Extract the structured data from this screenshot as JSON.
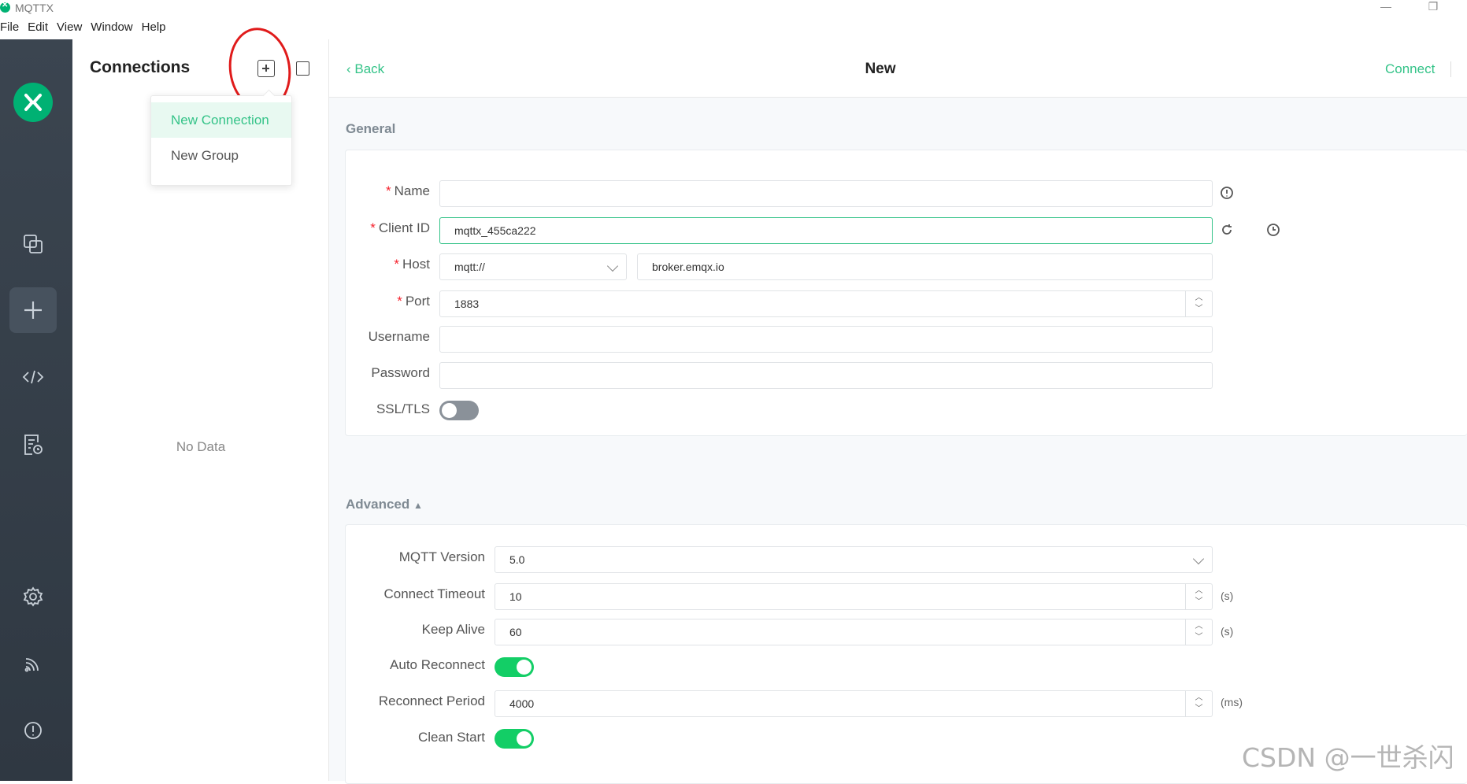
{
  "window": {
    "title": "MQTTX",
    "minimize_glyph": "—",
    "maximize_glyph": "❐"
  },
  "menu": [
    "File",
    "Edit",
    "View",
    "Window",
    "Help"
  ],
  "nav": {
    "items": [
      "connections-icon",
      "new-connection-icon",
      "script-icon",
      "log-icon",
      "settings-icon",
      "subscribe-feed-icon",
      "about-icon"
    ],
    "active": "new-connection-icon"
  },
  "connections": {
    "title": "Connections",
    "dropdown": [
      "New Connection",
      "New Group"
    ],
    "empty_text": "No Data"
  },
  "topbar": {
    "back_label": "Back",
    "title": "New",
    "connect_label": "Connect"
  },
  "general": {
    "section_label": "General",
    "name_label": "Name",
    "name_value": "",
    "client_id_label": "Client ID",
    "client_id_value": "mqttx_455ca222",
    "host_label": "Host",
    "host_protocol": "mqtt://",
    "host_value": "broker.emqx.io",
    "port_label": "Port",
    "port_value": "1883",
    "username_label": "Username",
    "username_value": "",
    "password_label": "Password",
    "password_value": "",
    "ssl_label": "SSL/TLS",
    "ssl_enabled": false
  },
  "advanced": {
    "section_label": "Advanced",
    "mqtt_version_label": "MQTT Version",
    "mqtt_version_value": "5.0",
    "connect_timeout_label": "Connect Timeout",
    "connect_timeout_value": "10",
    "connect_timeout_unit": "(s)",
    "keep_alive_label": "Keep Alive",
    "keep_alive_value": "60",
    "keep_alive_unit": "(s)",
    "auto_reconnect_label": "Auto Reconnect",
    "auto_reconnect_enabled": true,
    "reconnect_period_label": "Reconnect Period",
    "reconnect_period_value": "4000",
    "reconnect_period_unit": "(ms)",
    "clean_start_label": "Clean Start",
    "clean_start_enabled": true
  },
  "colors": {
    "accent": "#34c388",
    "switch_on": "#13ce66",
    "nav_bg": "#343e48",
    "annotation_red": "#e01b1b"
  },
  "watermark": "CSDN @一世杀闪"
}
